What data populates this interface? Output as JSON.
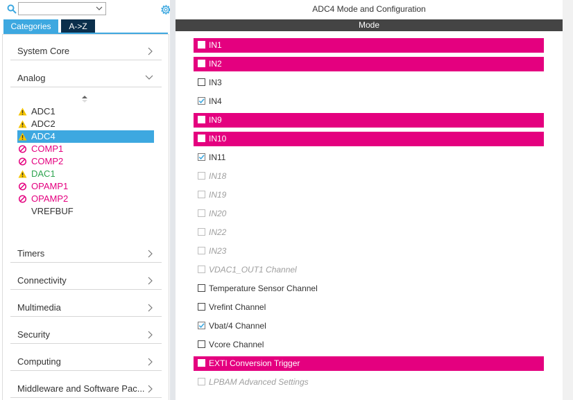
{
  "left": {
    "tabs": {
      "categories": "Categories",
      "az": "A->Z"
    },
    "categories_top": [
      {
        "label": "System Core",
        "chevron": "right"
      },
      {
        "label": "Analog",
        "chevron": "down"
      }
    ],
    "peripherals": [
      {
        "name": "ADC1",
        "status": "warning",
        "color": "#333333"
      },
      {
        "name": "ADC2",
        "status": "warning",
        "color": "#333333"
      },
      {
        "name": "ADC4",
        "status": "warning",
        "color": "#ffffff",
        "selected": true
      },
      {
        "name": "COMP1",
        "status": "disabled",
        "color": "#e4007f"
      },
      {
        "name": "COMP2",
        "status": "disabled",
        "color": "#e4007f"
      },
      {
        "name": "DAC1",
        "status": "warning",
        "color": "#2ea44f"
      },
      {
        "name": "OPAMP1",
        "status": "disabled",
        "color": "#e4007f"
      },
      {
        "name": "OPAMP2",
        "status": "disabled",
        "color": "#e4007f"
      },
      {
        "name": "VREFBUF",
        "status": "none",
        "color": "#333333"
      }
    ],
    "categories_bottom": [
      {
        "label": "Timers"
      },
      {
        "label": "Connectivity"
      },
      {
        "label": "Multimedia"
      },
      {
        "label": "Security"
      },
      {
        "label": "Computing"
      },
      {
        "label": "Middleware and Software Pac..."
      }
    ]
  },
  "right": {
    "title": "ADC4 Mode and Configuration",
    "mode_header": "Mode",
    "options": [
      {
        "label": "IN1",
        "state": "highlight",
        "checked": false
      },
      {
        "label": "IN2",
        "state": "highlight",
        "checked": false
      },
      {
        "label": "IN3",
        "state": "normal",
        "checked": false
      },
      {
        "label": "IN4",
        "state": "normal",
        "checked": true
      },
      {
        "label": "IN9",
        "state": "highlight",
        "checked": false
      },
      {
        "label": "IN10",
        "state": "highlight",
        "checked": false
      },
      {
        "label": "IN11",
        "state": "normal",
        "checked": true
      },
      {
        "label": "IN18",
        "state": "disabled",
        "checked": false
      },
      {
        "label": "IN19",
        "state": "disabled",
        "checked": false
      },
      {
        "label": "IN20",
        "state": "disabled",
        "checked": false
      },
      {
        "label": "IN22",
        "state": "disabled",
        "checked": false
      },
      {
        "label": "IN23",
        "state": "disabled",
        "checked": false
      },
      {
        "label": "VDAC1_OUT1 Channel",
        "state": "disabled",
        "checked": false
      },
      {
        "label": "Temperature Sensor Channel",
        "state": "normal",
        "checked": false
      },
      {
        "label": "Vrefint Channel",
        "state": "normal",
        "checked": false
      },
      {
        "label": "Vbat/4 Channel",
        "state": "normal",
        "checked": true
      },
      {
        "label": "Vcore Channel",
        "state": "normal",
        "checked": false
      },
      {
        "label": "EXTI Conversion Trigger",
        "state": "highlight",
        "checked": false
      },
      {
        "label": "LPBAM Advanced Settings",
        "state": "disabled",
        "checked": false
      }
    ]
  },
  "colors": {
    "accent": "#3da8e0",
    "highlight": "#e4007f",
    "tab_dark": "#0b2f4c",
    "mode_bar": "#444444",
    "warning": "#f5c400"
  }
}
